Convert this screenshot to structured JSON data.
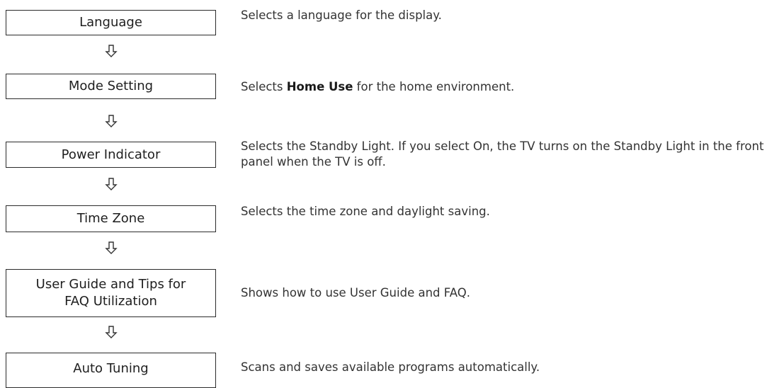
{
  "steps": [
    {
      "label": "Language",
      "description": "Selects a language for the display."
    },
    {
      "label": "Mode Setting",
      "description_prefix": "Selects ",
      "description_bold": "Home Use",
      "description_suffix": " for the home environment."
    },
    {
      "label": "Power Indicator",
      "description": "Selects the Standby Light. If you select On, the TV turns on the Standby Light in the front panel when the TV is off."
    },
    {
      "label": "Time Zone",
      "description": "Selects the time zone and daylight saving."
    },
    {
      "label_line1": "User Guide and Tips for",
      "label_line2": "FAQ Utilization",
      "description": "Shows how to use User Guide and FAQ."
    },
    {
      "label": "Auto Tuning",
      "description": "Scans and saves available programs automatically."
    }
  ],
  "connector_icon": "down-arrow-icon",
  "colors": {
    "box_border": "#2b2b2b",
    "text": "#333333"
  }
}
